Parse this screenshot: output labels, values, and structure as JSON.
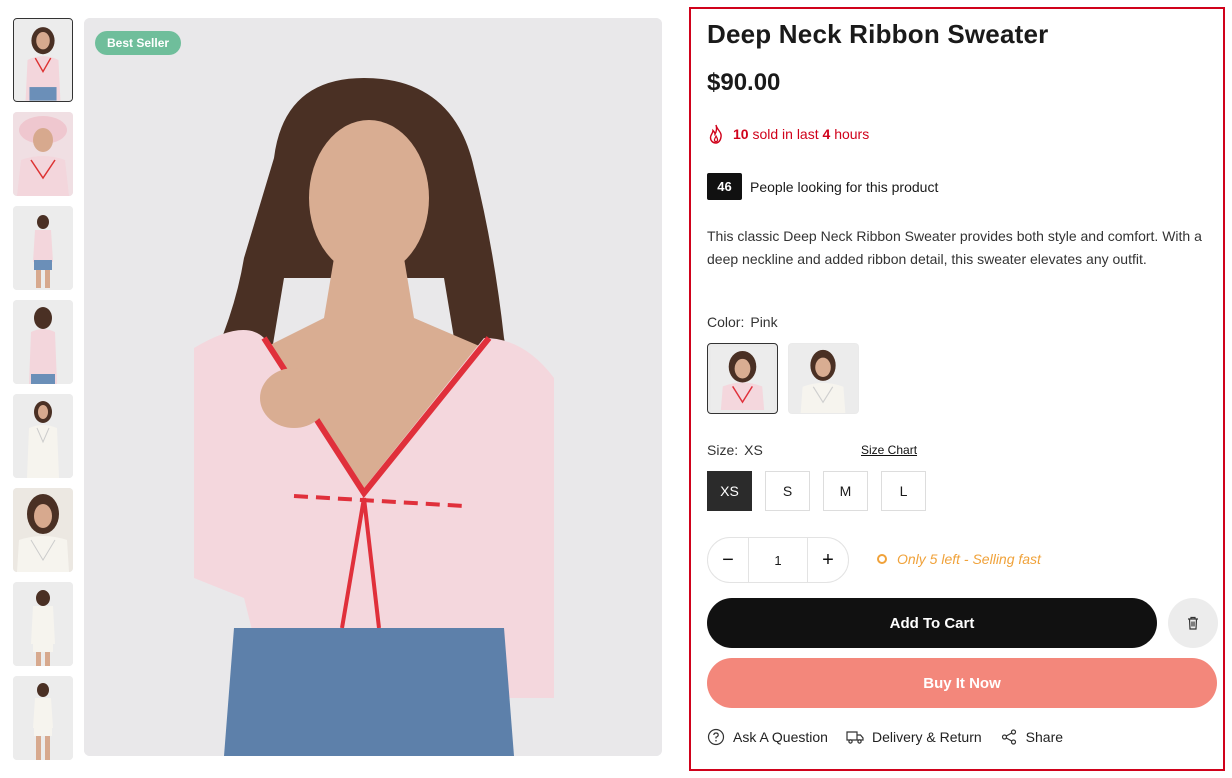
{
  "gallery": {
    "badge": "Best Seller",
    "thumbnails": [
      {
        "name": "thumb-pink-front",
        "tone": "pink"
      },
      {
        "name": "thumb-pink-closeup",
        "tone": "pink"
      },
      {
        "name": "thumb-pink-full",
        "tone": "pink"
      },
      {
        "name": "thumb-pink-back",
        "tone": "pink"
      },
      {
        "name": "thumb-white-front",
        "tone": "white"
      },
      {
        "name": "thumb-white-closeup",
        "tone": "white"
      },
      {
        "name": "thumb-white-back",
        "tone": "white"
      },
      {
        "name": "thumb-white-full",
        "tone": "white"
      }
    ]
  },
  "product": {
    "title": "Deep Neck Ribbon Sweater",
    "price": "$90.00",
    "sold_count": "10",
    "sold_mid": " sold in last ",
    "sold_hours": "4",
    "sold_end": " hours",
    "looking_count": "46",
    "looking_text": "People looking for this product",
    "description": "This classic Deep Neck Ribbon Sweater provides both style and comfort. With a deep neckline and added ribbon detail, this sweater elevates any outfit."
  },
  "color": {
    "label": "Color:",
    "selected": "Pink",
    "options": [
      "Pink",
      "White"
    ]
  },
  "size": {
    "label": "Size:",
    "selected": "XS",
    "chart_link": "Size Chart",
    "options": [
      "XS",
      "S",
      "M",
      "L"
    ]
  },
  "quantity": {
    "minus": "−",
    "value": "1",
    "plus": "+"
  },
  "stock_note": "Only 5 left - Selling fast",
  "actions": {
    "add_to_cart": "Add To Cart",
    "buy_now": "Buy It Now"
  },
  "links": {
    "ask": "Ask A Question",
    "delivery": "Delivery & Return",
    "share": "Share"
  },
  "colors": {
    "accent_red": "#d0021b",
    "badge_green": "#6fbe9b",
    "buy_now": "#f3877b",
    "stock_orange": "#f0a23a",
    "primary_button": "#111111"
  }
}
